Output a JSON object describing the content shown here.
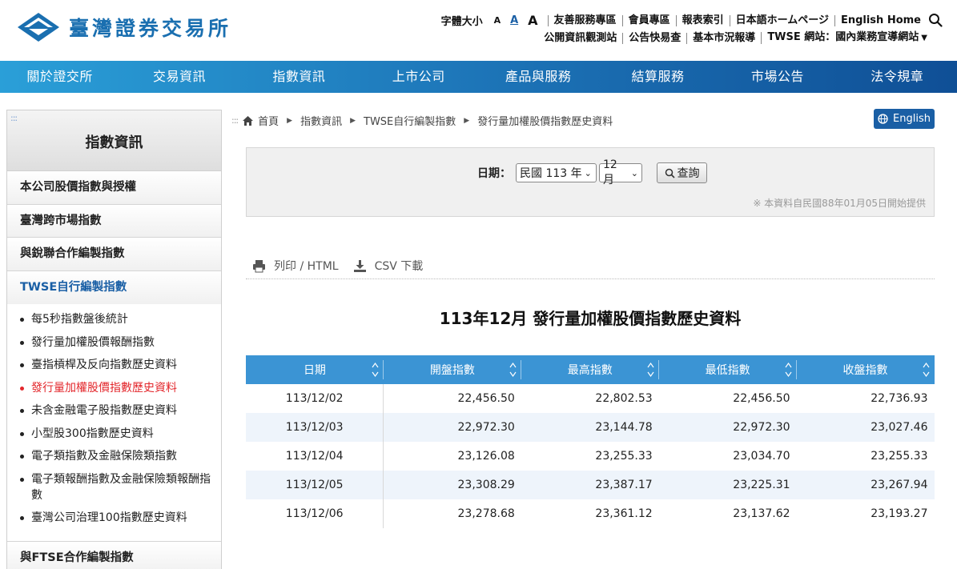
{
  "header": {
    "site_title": "臺灣證券交易所",
    "font_size_label": "字體大小",
    "font_sizes": [
      "A",
      "A",
      "A"
    ],
    "links_row1": [
      "友善服務專區",
      "會員專區",
      "報表索引",
      "日本語ホームページ",
      "English Home"
    ],
    "links_row2": [
      "公開資訊觀測站",
      "公告快易查",
      "基本市況報導",
      "TWSE 網站：國內業務宣導網站"
    ]
  },
  "nav": {
    "items": [
      "關於證交所",
      "交易資訊",
      "指數資訊",
      "上市公司",
      "產品與服務",
      "結算服務",
      "市場公告",
      "法令規章"
    ]
  },
  "sidebar": {
    "dots": ":::",
    "title": "指數資訊",
    "categories": [
      "本公司股價指數與授權",
      "臺灣跨市場指數",
      "與銳聯合作編製指數",
      "TWSE自行編製指數"
    ],
    "sub_items": [
      "每5秒指數盤後統計",
      "發行量加權股價報酬指數",
      "臺指槓桿及反向指數歷史資料",
      "發行量加權股價指數歷史資料",
      "未含金融電子股指數歷史資料",
      "小型股300指數歷史資料",
      "電子類指數及金融保險類指數",
      "電子類報酬指數及金融保險類報酬指數",
      "臺灣公司治理100指數歷史資料"
    ],
    "bottom_category": "與FTSE合作編製指數"
  },
  "breadcrumb": {
    "dots": ":::",
    "items": [
      "首頁",
      "指數資訊",
      "TWSE自行編製指數",
      "發行量加權股價指數歷史資料"
    ]
  },
  "english_button": "English",
  "query": {
    "date_label": "日期：",
    "year_value": "民國 113 年",
    "month_value": "12月",
    "button_label": "查詢",
    "note": "※ 本資料自民國88年01月05日開始提供"
  },
  "tools": {
    "print_label": "列印 / HTML",
    "csv_label": "CSV 下載"
  },
  "table": {
    "title": "113年12月 發行量加權股價指數歷史資料",
    "columns": [
      "日期",
      "開盤指數",
      "最高指數",
      "最低指數",
      "收盤指數"
    ],
    "rows": [
      [
        "113/12/02",
        "22,456.50",
        "22,802.53",
        "22,456.50",
        "22,736.93"
      ],
      [
        "113/12/03",
        "22,972.30",
        "23,144.78",
        "22,972.30",
        "23,027.46"
      ],
      [
        "113/12/04",
        "23,126.08",
        "23,255.33",
        "23,034.70",
        "23,255.33"
      ],
      [
        "113/12/05",
        "23,308.29",
        "23,387.17",
        "23,225.31",
        "23,267.94"
      ],
      [
        "113/12/06",
        "23,278.68",
        "23,361.12",
        "23,137.62",
        "23,193.27"
      ]
    ]
  },
  "colors": {
    "brand_blue": "#1a5fa5",
    "nav_gradient_start": "#2a9fd8",
    "nav_gradient_end": "#0f4f96",
    "table_header": "#3b94d4",
    "active_link": "#e3272c"
  }
}
